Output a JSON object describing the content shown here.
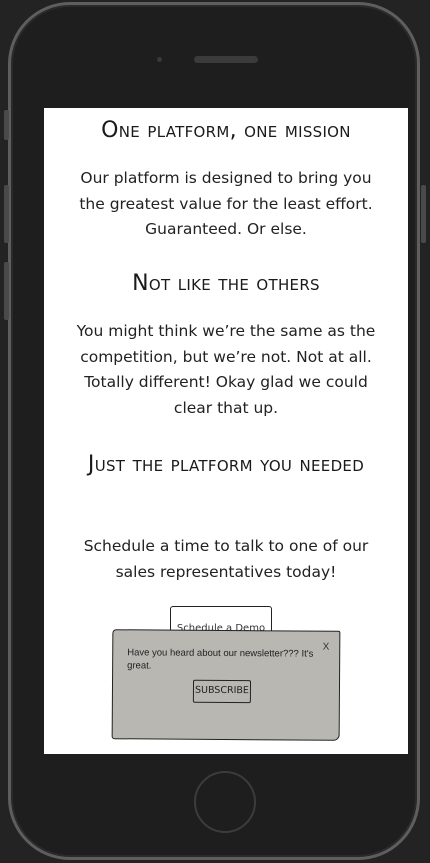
{
  "sections": [
    {
      "heading": "One platform, one mission",
      "body": "Our platform is designed to bring you the greatest value for the least effort. Guaranteed. Or else."
    },
    {
      "heading": "Not like the others",
      "body": "You might think we’re the same as the competition, but we’re not. Not at all. Totally different! Okay glad we could clear that up."
    },
    {
      "heading": "Just the platform you needed",
      "body": "Schedule a time to talk to one of our sales representatives today!"
    }
  ],
  "demo_button": {
    "label": "Schedule a Demo"
  },
  "newsletter_popup": {
    "message": "Have you heard about our newsletter??? It's great.",
    "close_label": "X",
    "subscribe_label": "SUBSCRIBE"
  }
}
